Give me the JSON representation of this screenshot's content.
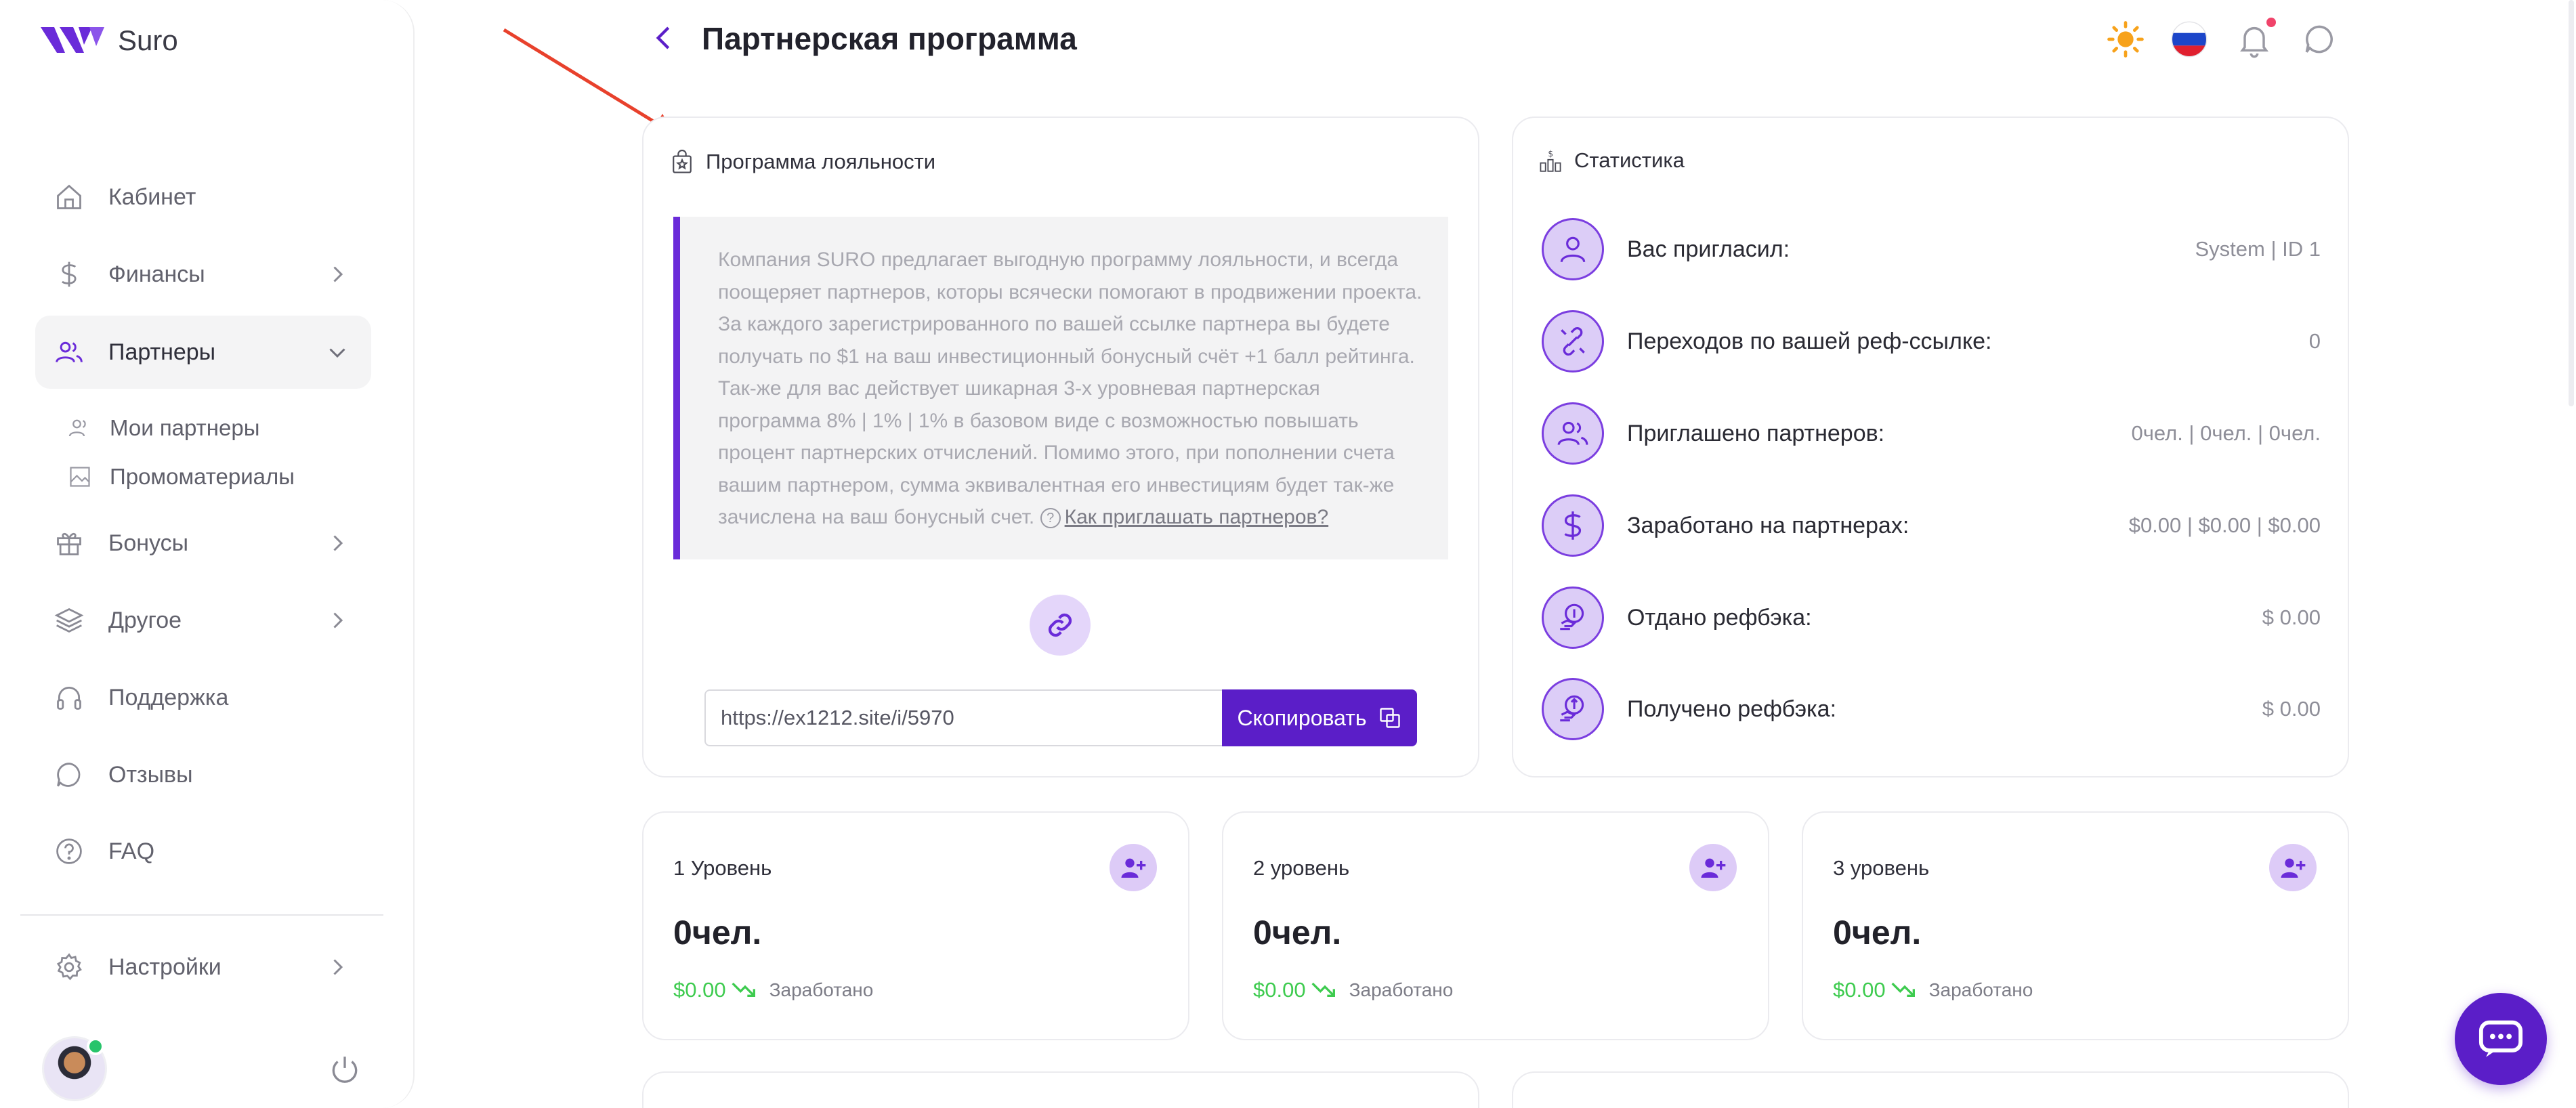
{
  "app": {
    "name": "Suro"
  },
  "sidebar": {
    "items": [
      {
        "label": "Кабинет",
        "icon": "home-icon"
      },
      {
        "label": "Финансы",
        "icon": "dollar-icon"
      },
      {
        "label": "Партнеры",
        "icon": "users-icon",
        "active": true
      },
      {
        "label": "Бонусы",
        "icon": "gift-icon"
      },
      {
        "label": "Другое",
        "icon": "layers-icon"
      },
      {
        "label": "Поддержка",
        "icon": "headphones-icon"
      },
      {
        "label": "Отзывы",
        "icon": "message-icon"
      },
      {
        "label": "FAQ",
        "icon": "help-icon"
      },
      {
        "label": "Настройки",
        "icon": "gear-icon"
      }
    ],
    "sub_items": [
      {
        "label": "Мои партнеры",
        "icon": "users-small-icon"
      },
      {
        "label": "Промоматериалы",
        "icon": "image-icon"
      }
    ]
  },
  "header": {
    "title": "Партнерская программа"
  },
  "loyalty": {
    "title": "Программа лояльности",
    "text": "Компания SURO предлагает выгодную программу лояльности, и всегда поощеряет партнеров, которы всячески помогают в продвижении проекта. За каждого зарегистрированного по вашей ссылке партнера вы будете получать по $1 на ваш инвестиционный бонусный счёт +1 балл рейтинга. Так-же для вас действует шикарная 3-х уровневая партнерская программа 8% | 1% | 1% в базовом виде с возможностью повышать процент партнерских отчислений. Помимо этого, при пополнении счета вашим партнером, сумма эквивалентная его инвестициям будет так-же зачислена на ваш бонусный счет.",
    "help_link": "Как приглашать партнеров?",
    "ref_link": "https://ex1212.site/i/5970",
    "copy_label": "Скопировать"
  },
  "stats": {
    "title": "Статистика",
    "rows": [
      {
        "label": "Вас пригласил:",
        "value": "System | ID 1",
        "icon": "user-icon"
      },
      {
        "label": "Переходов по вашей реф-ссылке:",
        "value": "0",
        "icon": "link-broken-icon"
      },
      {
        "label": "Приглашено партнеров:",
        "value": "0чел. | 0чел. | 0чел.",
        "icon": "users-icon"
      },
      {
        "label": "Заработано на партнерах:",
        "value": "$0.00 | $0.00 | $0.00",
        "icon": "dollar-icon"
      },
      {
        "label": "Отдано рефбэка:",
        "value": "$ 0.00",
        "icon": "coin-hand-out-icon"
      },
      {
        "label": "Получено рефбэка:",
        "value": "$ 0.00",
        "icon": "coin-hand-in-icon"
      }
    ]
  },
  "levels": [
    {
      "title": "1 Уровень",
      "count": "0чел.",
      "amount": "$0.00",
      "earned_label": "Заработано"
    },
    {
      "title": "2 уровень",
      "count": "0чел.",
      "amount": "$0.00",
      "earned_label": "Заработано"
    },
    {
      "title": "3 уровень",
      "count": "0чел.",
      "amount": "$0.00",
      "earned_label": "Заработано"
    }
  ],
  "colors": {
    "accent": "#5b1ec8",
    "accent_light": "#ddcbf7",
    "positive": "#3ecb4f",
    "annotation_arrow": "#e8412c"
  }
}
